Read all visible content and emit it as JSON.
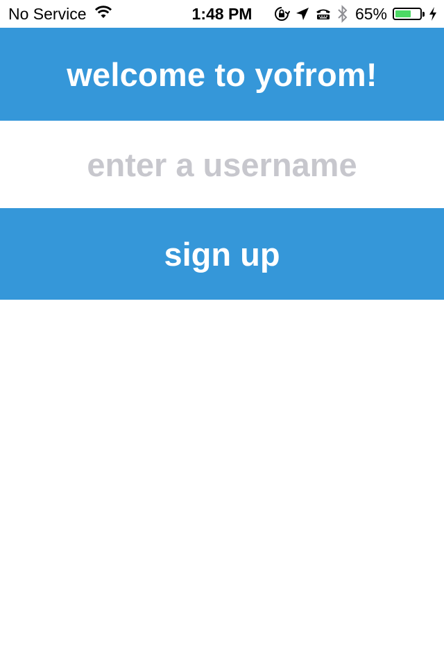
{
  "status_bar": {
    "carrier": "No Service",
    "time": "1:48 PM",
    "battery_percent_text": "65%",
    "battery_level": 0.65,
    "battery_color": "#4cd964",
    "icons": [
      "wifi-icon",
      "rotation-lock-icon",
      "location-arrow-icon",
      "tty-icon",
      "bluetooth-icon",
      "battery-icon",
      "charging-bolt-icon"
    ]
  },
  "header": {
    "title": "welcome to yofrom!",
    "background": "#3597d9"
  },
  "username": {
    "placeholder": "enter a username",
    "value": ""
  },
  "signup": {
    "label": "sign up",
    "background": "#3597d9"
  }
}
